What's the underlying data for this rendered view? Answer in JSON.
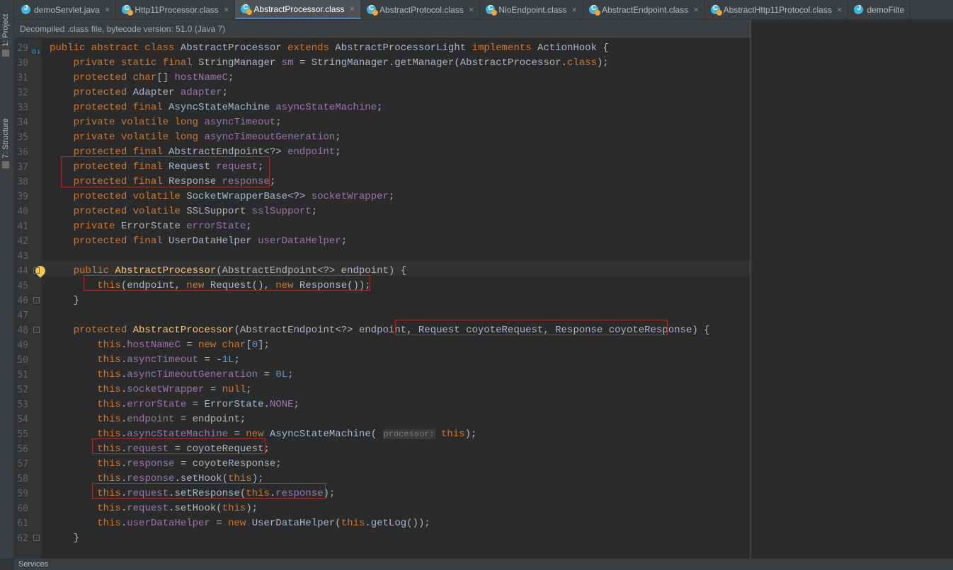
{
  "side": {
    "project": "1: Project",
    "structure": "7: Structure"
  },
  "tabs": [
    {
      "label": "demoServlet.java",
      "kind": "jc",
      "active": false
    },
    {
      "label": "Http11Processor.class",
      "kind": "cls",
      "active": false
    },
    {
      "label": "AbstractProcessor.class",
      "kind": "cls",
      "active": true
    },
    {
      "label": "AbstractProtocol.class",
      "kind": "cls",
      "active": false
    },
    {
      "label": "NioEndpoint.class",
      "kind": "cls",
      "active": false
    },
    {
      "label": "AbstractEndpoint.class",
      "kind": "cls",
      "active": false
    },
    {
      "label": "AbstractHttp11Protocol.class",
      "kind": "cls",
      "active": false
    },
    {
      "label": "demoFilte",
      "kind": "jc",
      "active": false,
      "noclose": true
    }
  ],
  "banner": "Decompiled .class file, bytecode version: 51.0 (Java 7)",
  "gutter": {
    "start": 29,
    "end": 62
  },
  "code": {
    "l29": {
      "pre": "public abstract class ",
      "name": "AbstractProcessor",
      "ext": " extends ",
      "sup": "AbstractProcessorLight",
      "impl": " implements ",
      "iface": "ActionHook",
      "tail": " {"
    },
    "l30": "private static final StringManager sm = StringManager.getManager(AbstractProcessor.class);",
    "l31": "protected char[] hostNameC;",
    "l32": "protected Adapter adapter;",
    "l33": "protected final AsyncStateMachine asyncStateMachine;",
    "l34": "private volatile long asyncTimeout;",
    "l35": "private volatile long asyncTimeoutGeneration;",
    "l36": "protected final AbstractEndpoint<?> endpoint;",
    "l37": "protected final Request request;",
    "l38": "protected final Response response;",
    "l39": "protected volatile SocketWrapperBase<?> socketWrapper;",
    "l40": "protected volatile SSLSupport sslSupport;",
    "l41": "private ErrorState errorState;",
    "l42": "protected final UserDataHelper userDataHelper;",
    "l44": "public AbstractProcessor(AbstractEndpoint<?> endpoint) {",
    "l45": "this(endpoint, new Request(), new Response());",
    "l46": "}",
    "l48a": "protected AbstractProcessor(AbstractEndpoint<?> endpoint,",
    "l48b": "Request coyoteRequest, Response coyoteResponse)",
    "l48c": " {",
    "l49": "this.hostNameC = new char[0];",
    "l50": "this.asyncTimeout = -1L;",
    "l51": "this.asyncTimeoutGeneration = 0L;",
    "l52": "this.socketWrapper = null;",
    "l53": "this.errorState = ErrorState.NONE;",
    "l54": "this.endpoint = endpoint;",
    "l55": "this.asyncStateMachine = new AsyncStateMachine( processor: this);",
    "l56": "this.request = coyoteRequest;",
    "l57": "this.response = coyoteResponse;",
    "l58": "this.response.setHook(this);",
    "l59": "this.request.setResponse(this.response);",
    "l60": "this.request.setHook(this);",
    "l61": "this.userDataHelper = new UserDataHelper(this.getLog());",
    "l62": "}"
  },
  "bottom": {
    "services": "Services"
  }
}
